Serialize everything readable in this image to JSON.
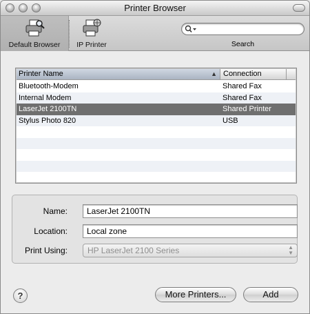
{
  "window": {
    "title": "Printer Browser"
  },
  "toolbar": {
    "default_browser_label": "Default Browser",
    "ip_printer_label": "IP Printer",
    "search_label": "Search",
    "search_value": ""
  },
  "printer_list": {
    "columns": [
      "Printer Name",
      "Connection"
    ],
    "rows": [
      {
        "name": "Bluetooth-Modem",
        "connection": "Shared Fax",
        "selected": false
      },
      {
        "name": "Internal Modem",
        "connection": "Shared Fax",
        "selected": false
      },
      {
        "name": "LaserJet 2100TN",
        "connection": "Shared Printer",
        "selected": true
      },
      {
        "name": "Stylus Photo 820",
        "connection": "USB",
        "selected": false
      },
      {
        "name": "",
        "connection": "",
        "selected": false
      },
      {
        "name": "",
        "connection": "",
        "selected": false
      },
      {
        "name": "",
        "connection": "",
        "selected": false
      },
      {
        "name": "",
        "connection": "",
        "selected": false
      },
      {
        "name": "",
        "connection": "",
        "selected": false
      }
    ]
  },
  "details": {
    "name_label": "Name:",
    "name_value": "LaserJet 2100TN",
    "location_label": "Location:",
    "location_value": "Local zone",
    "print_using_label": "Print Using:",
    "print_using_value": "HP LaserJet 2100 Series"
  },
  "buttons": {
    "help": "?",
    "more_printers": "More Printers...",
    "add": "Add"
  },
  "colors": {
    "selection": "#6f6f6f",
    "window": "#ececec"
  }
}
